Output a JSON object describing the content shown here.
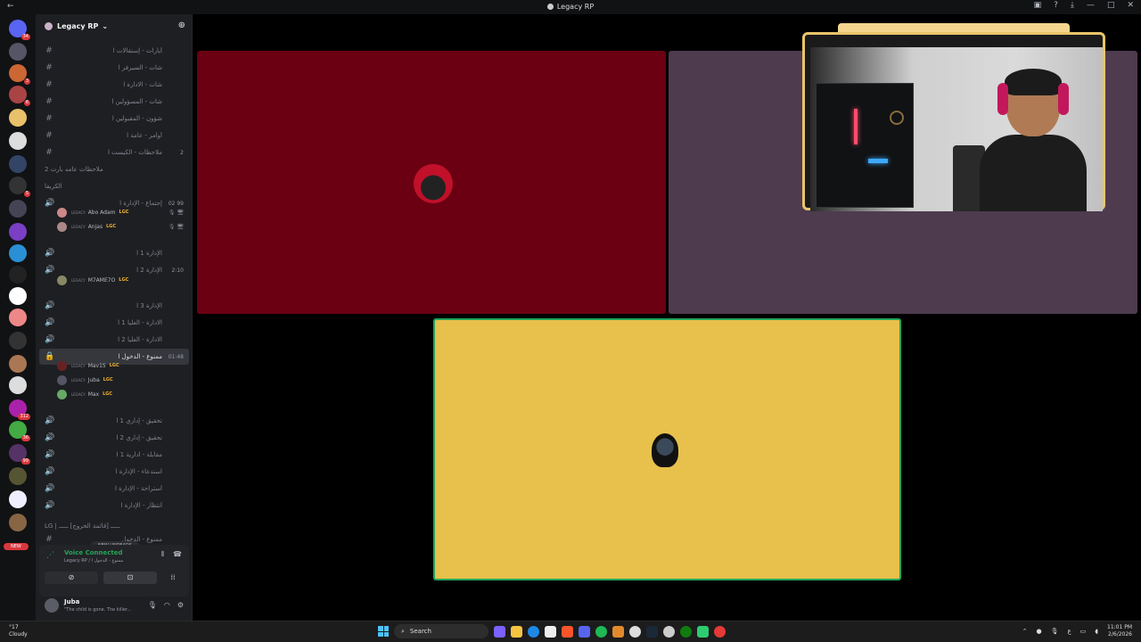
{
  "window": {
    "title": "Legacy RP"
  },
  "server": {
    "name": "Legacy RP"
  },
  "guild_badges": [
    "34",
    "3",
    "6",
    "5",
    "312",
    "36",
    "99"
  ],
  "new_pill": "NEW",
  "channels": [
    {
      "type": "text",
      "label": "أيارات - إستقالات ا"
    },
    {
      "type": "text",
      "label": "شات - السيرفر ا"
    },
    {
      "type": "text",
      "label": "شات - الادارة ا"
    },
    {
      "type": "text",
      "label": "شات - المسؤولين ا"
    },
    {
      "type": "text",
      "label": "شؤون - المقبولين ا"
    },
    {
      "type": "text",
      "label": "أوامر - عامة ا"
    },
    {
      "type": "text",
      "label": "ملاحظات - الكيست ا",
      "right": "2"
    },
    {
      "type": "sub",
      "label": "ملاحظات عامه بارت 2"
    },
    {
      "type": "sub",
      "label": "الكريفا"
    },
    {
      "type": "voice-live",
      "label": "إجتماع - الإدارة ا",
      "right": "02  99"
    },
    {
      "type": "voice",
      "label": "الإدارة 1 ا"
    },
    {
      "type": "voice-live",
      "label": "الإدارة 2 ا",
      "right": "2:10"
    },
    {
      "type": "voice",
      "label": "الإدارة 3 ا"
    },
    {
      "type": "voice",
      "label": "الادارة - العليا 1 ا"
    },
    {
      "type": "voice",
      "label": "الادارة - العليا 2 ا"
    },
    {
      "type": "voice-active",
      "label": "ممنوع - الدخول ا",
      "right": "01:48"
    },
    {
      "type": "voice",
      "label": "تحقيق - إداري 1 ا"
    },
    {
      "type": "voice",
      "label": "تحقيق - إداري 2 ا"
    },
    {
      "type": "voice",
      "label": "مقابلة - ادارية 1 ا"
    },
    {
      "type": "voice",
      "label": "استدعاء - الإدارة ا"
    },
    {
      "type": "voice",
      "label": "أستراحة - الإدارة ا"
    },
    {
      "type": "voice",
      "label": "أنتظار - الإدارة ا"
    },
    {
      "type": "category",
      "label": "LG | ـــــ [قائمة الخروج] ـــــ"
    },
    {
      "type": "text",
      "label": "ممنوع - الدخول"
    }
  ],
  "members": [
    {
      "name": "Abo Adam",
      "prefix": "LEGACY",
      "tag": "LGC",
      "avatar": "#c88",
      "icons": "🎙 🖥"
    },
    {
      "name": "Anjas",
      "prefix": "LEGACY",
      "tag": "LGC",
      "avatar": "#a88",
      "icons": "🎙 🖥"
    },
    {
      "name": "M7AME7O",
      "prefix": "LEGACY",
      "tag": "LGC",
      "avatar": "#886"
    },
    {
      "name": "Mav15",
      "prefix": "LEGACY",
      "tag": "LGC",
      "avatar": "#622"
    },
    {
      "name": "Juba",
      "prefix": "LEGACY",
      "tag": "LGC",
      "avatar": "#556"
    },
    {
      "name": "Max",
      "prefix": "LEGACY",
      "tag": "LGC",
      "avatar": "#6a6"
    }
  ],
  "new_unreads": "NEW UNREADS",
  "voice": {
    "status": "Voice Connected",
    "location": "ممنوع - الدخول ا / Legacy RP"
  },
  "user": {
    "name": "Juba",
    "status": "\"The child is gone. The killer..."
  },
  "tiles": [
    {
      "name": "red",
      "color": "#6b0012"
    },
    {
      "name": "purple",
      "color": "#4e3b4e"
    },
    {
      "name": "yellow",
      "color": "#e8c14c"
    }
  ],
  "taskbar": {
    "weather_temp": "°17",
    "weather_text": "Cloudy",
    "search": "Search",
    "time": "11:01 PM",
    "date": "2/6/2026"
  }
}
